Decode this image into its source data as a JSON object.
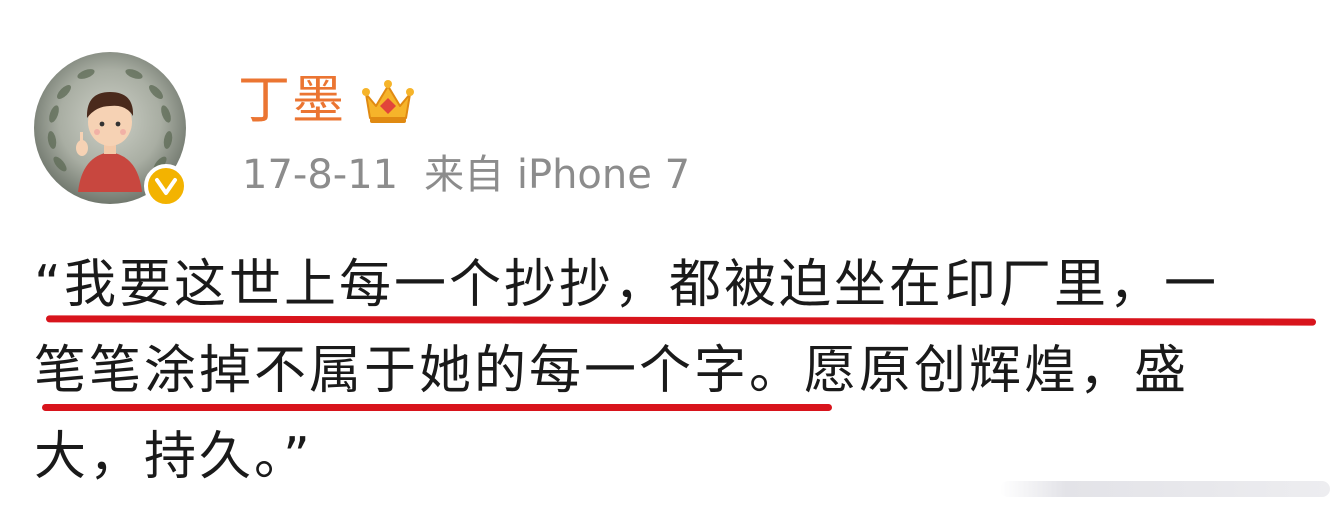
{
  "post": {
    "username": "丁墨",
    "date": "17-8-11",
    "source": "来自 iPhone 7",
    "content_lines": [
      "“我要这世上每一个抄抄，都被迫坐在印厂里，一",
      "笔笔涂掉不属于她的每一个字。愿原创辉煌，盛",
      "大，持久。”"
    ]
  },
  "icons": {
    "verified": "verified-badge-icon",
    "vip": "crown-icon"
  },
  "colors": {
    "username": "#eb7532",
    "meta": "#8c8c8c",
    "text": "#1a1a1a",
    "underline": "#d8141c",
    "verified_badge": "#f3b300"
  }
}
